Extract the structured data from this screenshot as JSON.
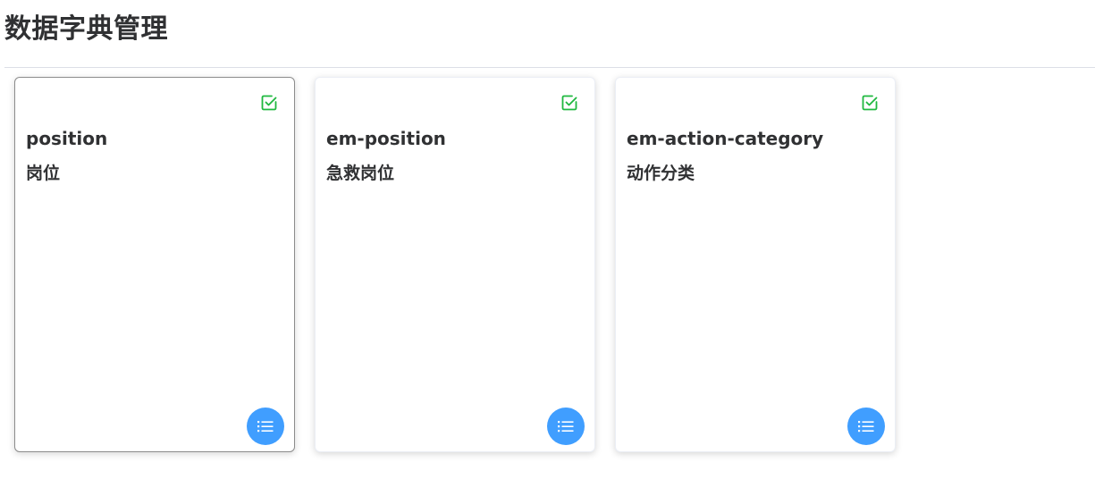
{
  "page": {
    "title": "数据字典管理"
  },
  "colors": {
    "accent": "#409eff",
    "check": "#1fb83f",
    "text": "#303133"
  },
  "cards": [
    {
      "code": "position",
      "name": "岗位",
      "selected": true,
      "status_icon": "check-square-icon",
      "action_icon": "list-icon"
    },
    {
      "code": "em-position",
      "name": "急救岗位",
      "selected": false,
      "status_icon": "check-square-icon",
      "action_icon": "list-icon"
    },
    {
      "code": "em-action-category",
      "name": "动作分类",
      "selected": false,
      "status_icon": "check-square-icon",
      "action_icon": "list-icon"
    }
  ]
}
